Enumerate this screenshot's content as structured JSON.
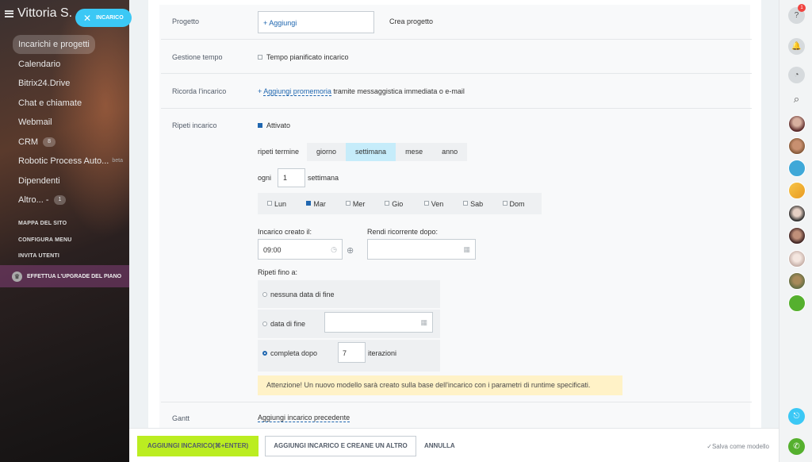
{
  "sidebar": {
    "company": "Vittoria S.",
    "items": [
      {
        "label": "Incarichi e progetti"
      },
      {
        "label": "Calendario"
      },
      {
        "label": "Bitrix24.Drive"
      },
      {
        "label": "Chat e chiamate"
      },
      {
        "label": "Webmail"
      },
      {
        "label": "CRM",
        "badge": "8"
      },
      {
        "label": "Robotic Process Auto...",
        "tag": "beta"
      },
      {
        "label": "Dipendenti"
      },
      {
        "label": "Altro... -",
        "badge": "1"
      }
    ],
    "links": [
      "MAPPA DEL SITO",
      "CONFIGURA MENU",
      "INVITA UTENTI"
    ],
    "upgrade": "EFFETTUA L'UPGRADE DEL PIANO"
  },
  "task_pill": {
    "label": "INCARICO"
  },
  "form": {
    "project": {
      "label": "Progetto",
      "add": "+ Aggiungi",
      "create": "Crea progetto"
    },
    "time": {
      "label": "Gestione tempo",
      "checkbox": "Tempo pianificato incarico"
    },
    "reminder": {
      "label": "Ricorda l'incarico",
      "plus": "+",
      "link": "Aggiungi promemoria",
      "rest": "tramite messaggistica immediata o e-mail"
    },
    "repeat": {
      "label": "Ripeti incarico",
      "enabled": "Attivato",
      "term_label": "ripeti termine",
      "terms": [
        "giorno",
        "settimana",
        "mese",
        "anno"
      ],
      "every_label": "ogni",
      "every_value": "1",
      "every_unit": "settimana",
      "days": [
        {
          "label": "Lun",
          "checked": false
        },
        {
          "label": "Mar",
          "checked": true
        },
        {
          "label": "Mer",
          "checked": false
        },
        {
          "label": "Gio",
          "checked": false
        },
        {
          "label": "Ven",
          "checked": false
        },
        {
          "label": "Sab",
          "checked": false
        },
        {
          "label": "Dom",
          "checked": false
        }
      ],
      "created_label": "Incarico creato il:",
      "created_value": "09:00",
      "recurrent_label": "Rendi ricorrente dopo:",
      "recurrent_value": "",
      "until_label": "Ripeti fino a:",
      "opt_none": "nessuna data di fine",
      "opt_date": "data di fine",
      "opt_after": "completa dopo",
      "iterations_value": "7",
      "iterations_label": "iterazioni",
      "warning": "Attenzione! Un nuovo modello sarà creato sulla base dell'incarico con i parametri di runtime specificati."
    },
    "gantt": {
      "label": "Gantt",
      "link": "Aggiungi incarico precedente"
    }
  },
  "bottom": {
    "primary": "AGGIUNGI INCARICO(⌘+ENTER)",
    "secondary": "AGGIUNGI INCARICO E CREANE UN ALTRO",
    "cancel": "ANNULLA",
    "save_template": "Salva come modello"
  },
  "rightbar": {
    "help_badge": "1"
  },
  "colors": {
    "accent": "#2067b0",
    "primary_button": "#bbed21",
    "pill": "#3bc8f5",
    "warning_bg": "#fff2c7"
  }
}
